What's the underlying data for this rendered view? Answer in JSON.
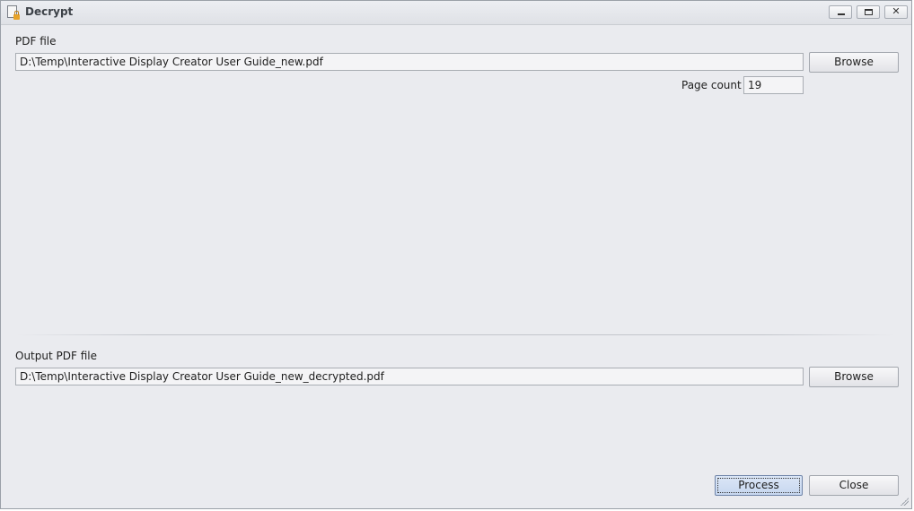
{
  "window": {
    "title": "Decrypt"
  },
  "input": {
    "label": "PDF file",
    "path": "D:\\Temp\\Interactive Display Creator User Guide_new.pdf",
    "browse_label": "Browse",
    "page_count_label": "Page count",
    "page_count_value": "19"
  },
  "output": {
    "label": "Output PDF file",
    "path": "D:\\Temp\\Interactive Display Creator User Guide_new_decrypted.pdf",
    "browse_label": "Browse"
  },
  "actions": {
    "process_label": "Process",
    "close_label": "Close"
  },
  "window_controls": {
    "close_glyph": "✕"
  },
  "icons": [
    "document-lock-icon",
    "minimize-icon",
    "maximize-icon",
    "close-icon",
    "resize-grip-icon"
  ]
}
